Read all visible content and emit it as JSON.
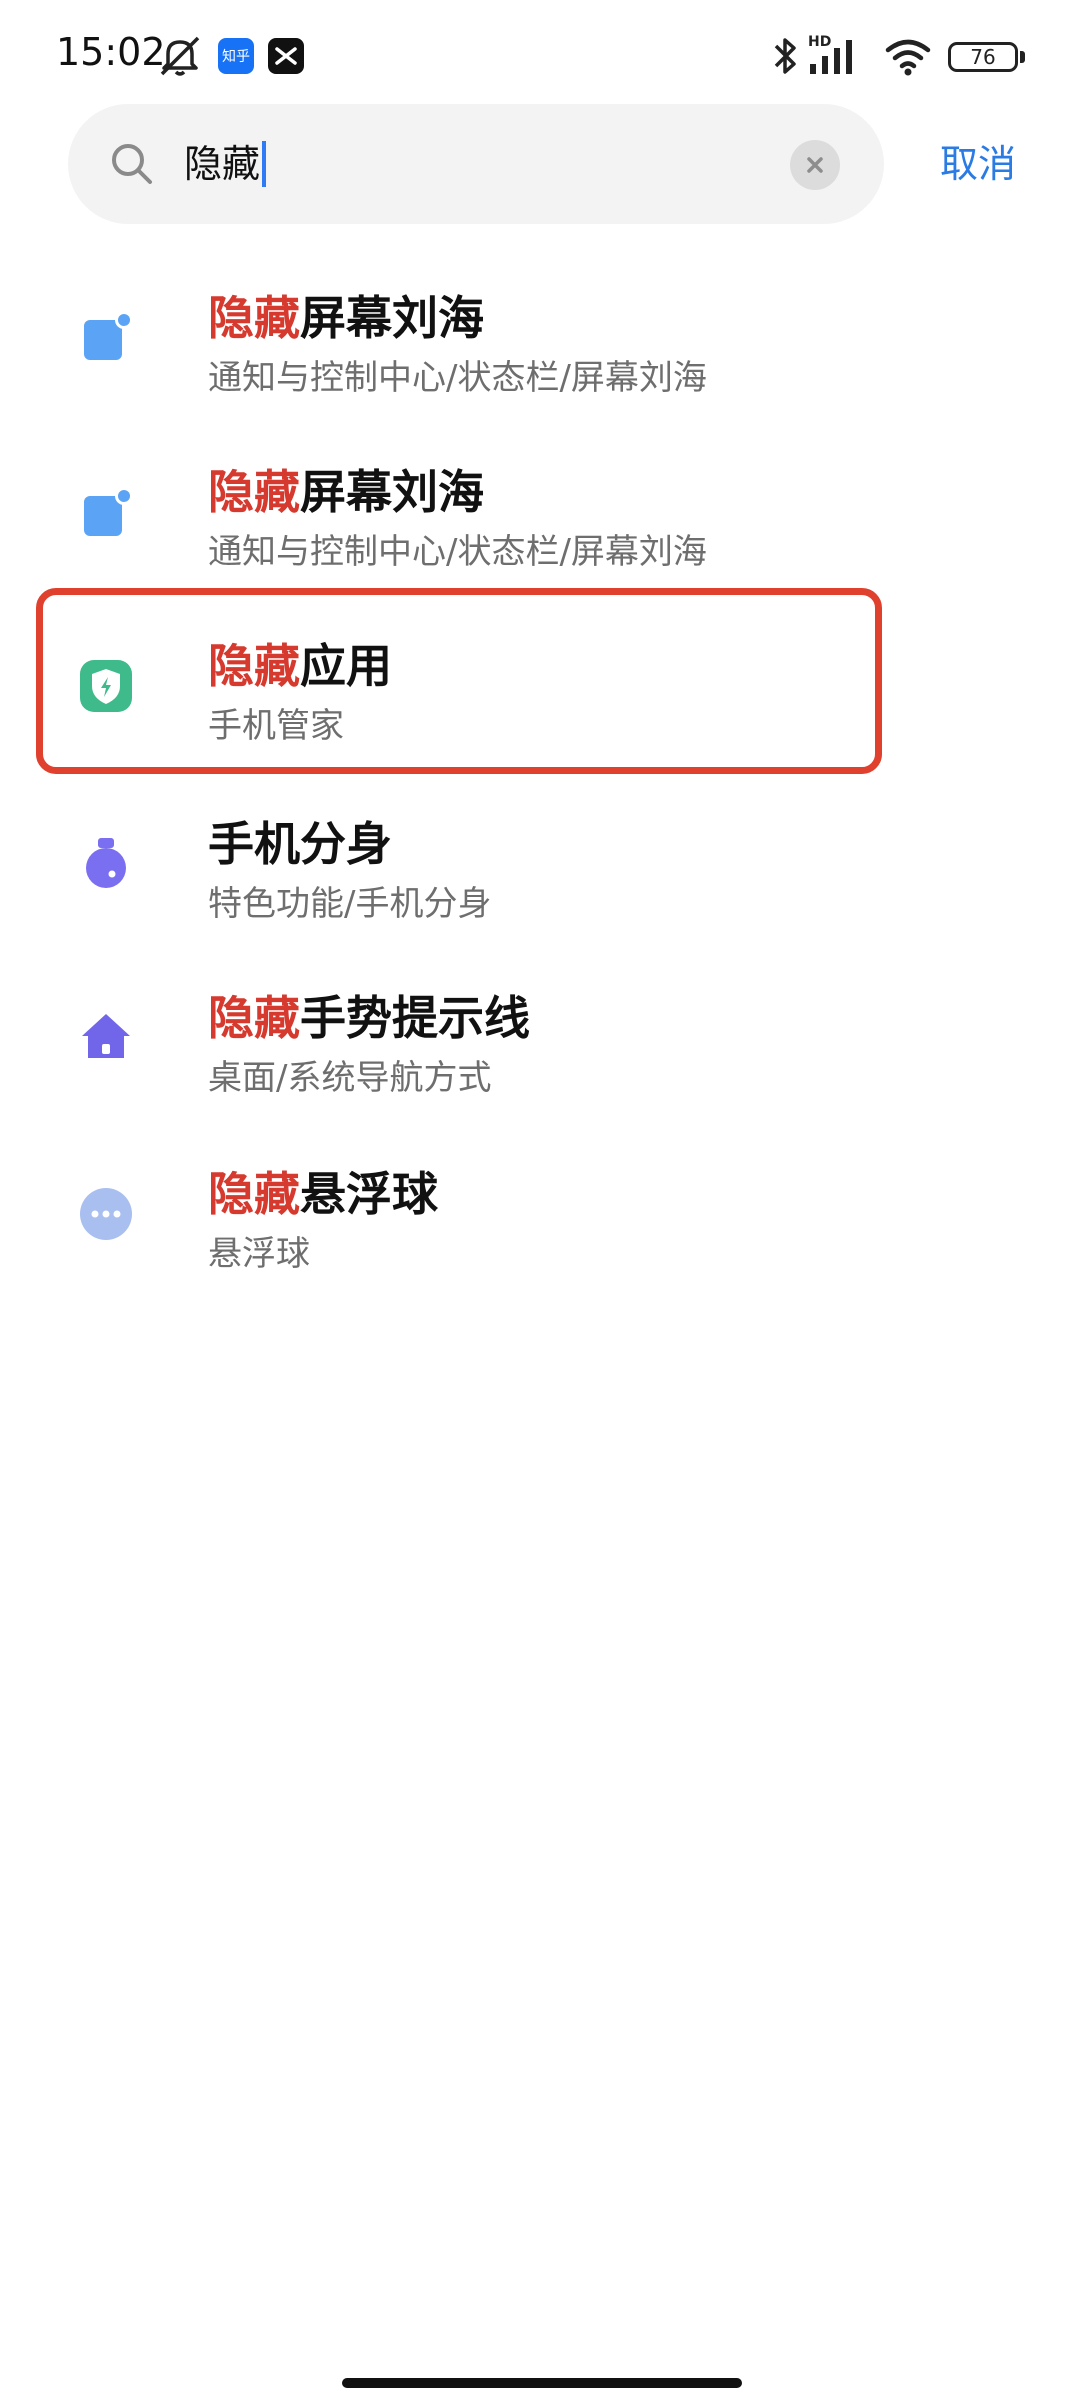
{
  "status_bar": {
    "time": "15:02",
    "zhihu_badge": "知乎",
    "battery": "76",
    "signal_label": "HD"
  },
  "search": {
    "query": "隐藏",
    "cancel_label": "取消"
  },
  "results": [
    {
      "highlight": "隐藏",
      "rest": "屏幕刘海",
      "path": "通知与控制中心/状态栏/屏幕刘海",
      "icon": "notch-icon"
    },
    {
      "highlight": "隐藏",
      "rest": "屏幕刘海",
      "path": "通知与控制中心/状态栏/屏幕刘海",
      "icon": "notch-icon"
    },
    {
      "highlight": "隐藏",
      "rest": "应用",
      "path": "手机管家",
      "icon": "security-shield-icon"
    },
    {
      "highlight": "",
      "rest": "手机分身",
      "path": "特色功能/手机分身",
      "icon": "second-space-icon"
    },
    {
      "highlight": "隐藏",
      "rest": "手势提示线",
      "path": "桌面/系统导航方式",
      "icon": "home-icon"
    },
    {
      "highlight": "隐藏",
      "rest": "悬浮球",
      "path": "悬浮球",
      "icon": "floating-ball-icon"
    }
  ],
  "colors": {
    "highlight_text": "#d63a2f",
    "accent": "#2a7ce4",
    "selection_box": "#e0402e"
  }
}
